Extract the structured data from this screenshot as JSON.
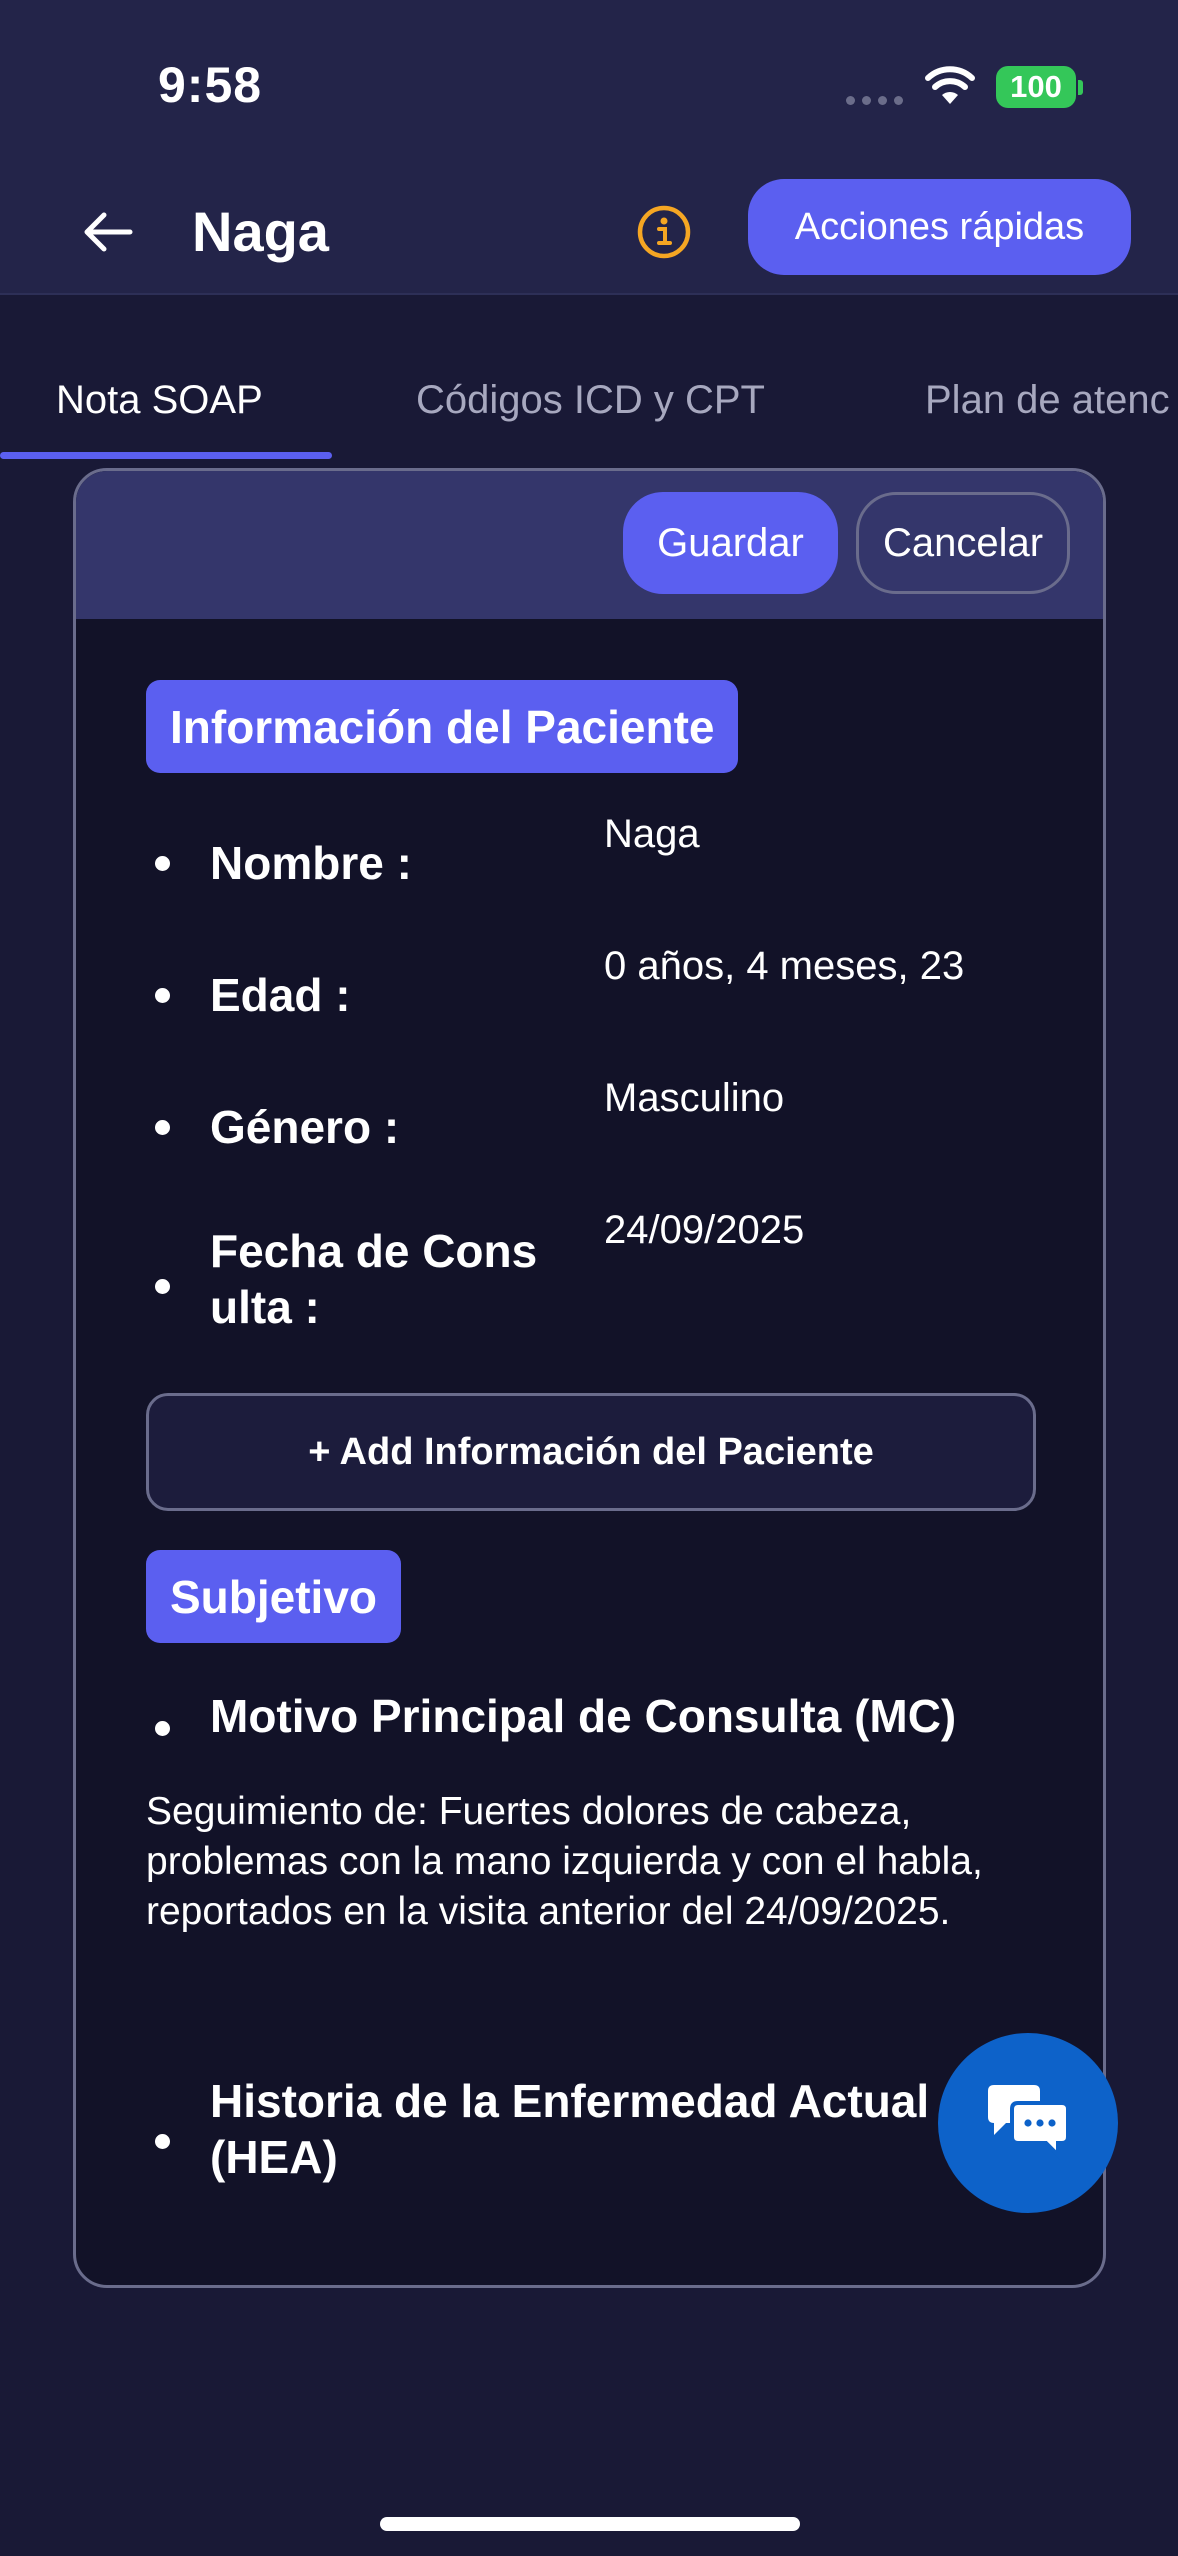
{
  "status_bar": {
    "time": "9:58",
    "battery": "100"
  },
  "header": {
    "title": "Naga",
    "quick_actions_label": "Acciones rápidas"
  },
  "tabs": [
    {
      "label": "Nota SOAP",
      "active": true
    },
    {
      "label": "Códigos ICD y CPT",
      "active": false
    },
    {
      "label": "Plan de atenc",
      "active": false
    }
  ],
  "toolbar": {
    "save_label": "Guardar",
    "cancel_label": "Cancelar"
  },
  "patient_info": {
    "section_title": "Información del Paciente",
    "fields": [
      {
        "label": "Nombre :",
        "value": "Naga"
      },
      {
        "label": "Edad :",
        "value": "0 años, 4 meses, 23"
      },
      {
        "label": "Género :",
        "value": "Masculino"
      },
      {
        "label": "Fecha de Cons ulta :",
        "value": "24/09/2025"
      }
    ],
    "add_button_label": "+  Add Información del Paciente"
  },
  "subjective": {
    "section_title": "Subjetivo",
    "chief_complaint_label": "Motivo Principal de Consulta (MC)",
    "chief_complaint_text": "Seguimiento de: Fuertes dolores de cabeza, problemas con la mano izquierda y con el habla, reportados en la visita anterior del 24/09/2025.",
    "hpi_label": "Historia de la Enfermedad Actual (HEA)"
  },
  "colors": {
    "accent": "#5b5ff0",
    "background": "#191936",
    "header": "#232449",
    "card": "#121228",
    "chat_button": "#0d62c9",
    "battery": "#34c759"
  },
  "icons": {
    "back": "arrow-left-icon",
    "info": "info-circle-icon",
    "chat": "chat-bubbles-icon",
    "wifi": "wifi-icon"
  }
}
